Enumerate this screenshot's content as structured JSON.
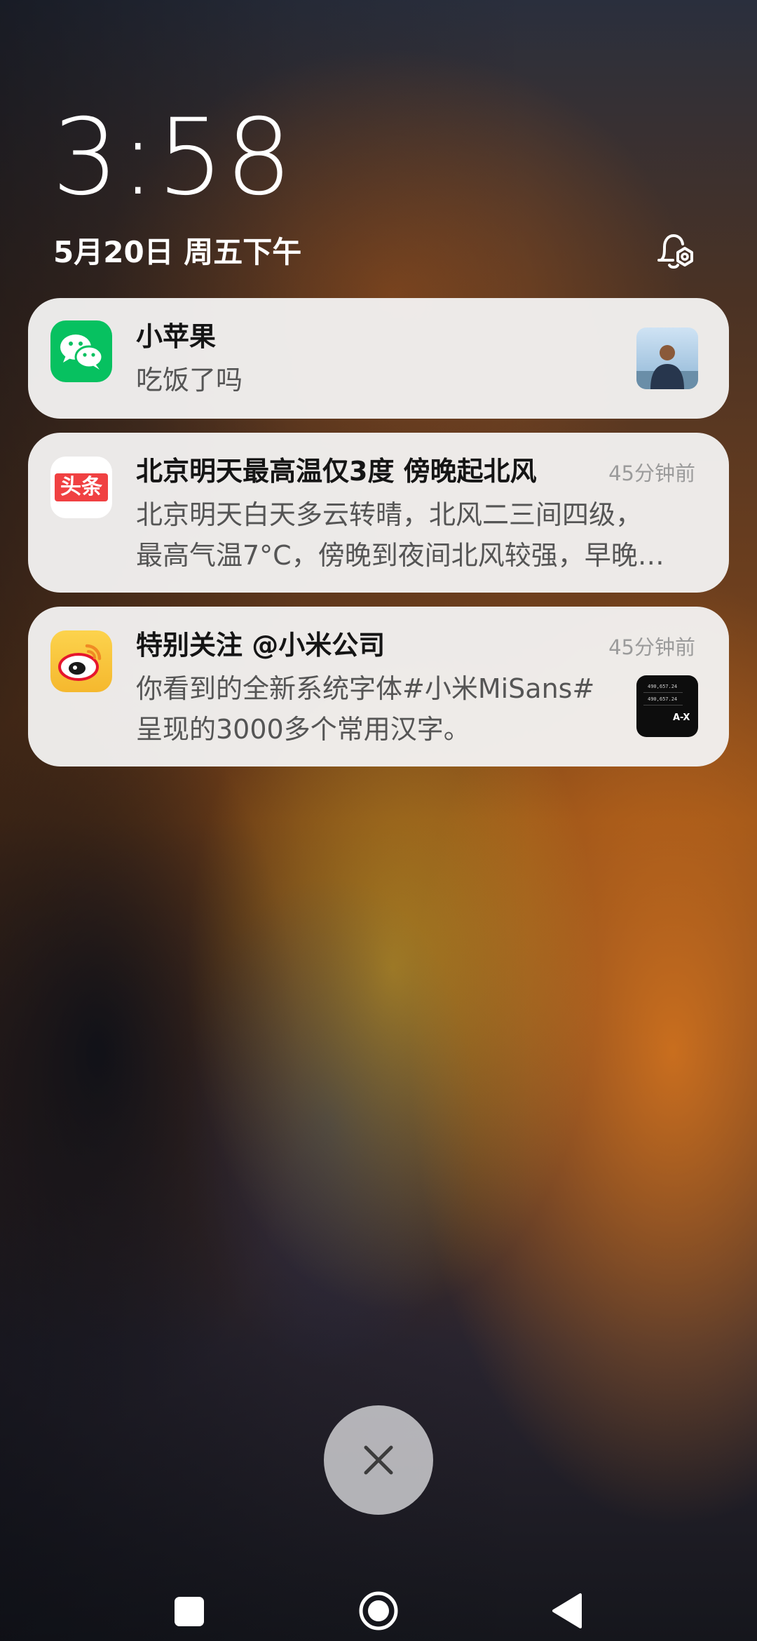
{
  "lockscreen": {
    "time": "3:58",
    "date": "5月20日 周五下午"
  },
  "notifications": [
    {
      "app": "WeChat",
      "title": "小苹果",
      "body": [
        "吃饭了吗"
      ],
      "time": ""
    },
    {
      "app": "今日头条",
      "icon_text": "头条",
      "title": "北京明天最高温仅3度 傍晚起北风",
      "body": [
        "北京明天白天多云转晴，北风二三间四级，",
        "最高气温7°C，傍晚到夜间北风较强，早晚…"
      ],
      "time": "45分钟前"
    },
    {
      "app": "Weibo",
      "title": "特别关注 @小米公司",
      "body": [
        "你看到的全新系统字体#小米MiSans#",
        "呈现的3000多个常用汉字。"
      ],
      "time": "45分钟前"
    }
  ],
  "thumbnail_calc": {
    "line1": "490,657.24",
    "line2": "490,657.24",
    "label": "A-X"
  },
  "colors": {
    "wechat_green": "#07C160",
    "toutiao_red": "#F04142",
    "weibo_yellow": "#F8C63A",
    "card_bg": "#F2F1F0"
  },
  "icons": {
    "bell": "bell-settings-icon",
    "dismiss": "close-icon",
    "recents": "square-icon",
    "home": "circle-icon",
    "back": "triangle-back-icon"
  }
}
